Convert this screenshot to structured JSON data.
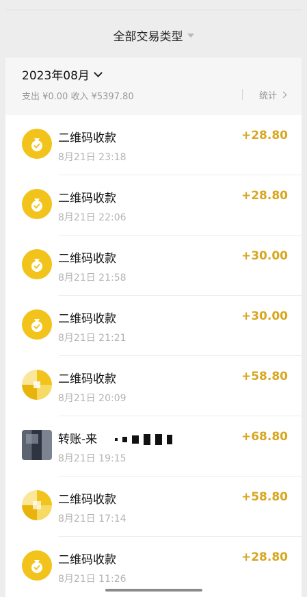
{
  "header": {
    "filter_label": "全部交易类型"
  },
  "month": {
    "label": "2023年08月",
    "summary": "支出 ¥0.00 收入 ¥5397.80",
    "stats_label": "统计"
  },
  "colors": {
    "accent_amount": "#d8a61f",
    "icon_yellow": "#f2c31a"
  },
  "transactions": [
    {
      "title": "二维码收款",
      "time": "8月21日 23:18",
      "amount": "+28.80",
      "icon": "money-bag-icon"
    },
    {
      "title": "二维码收款",
      "time": "8月21日 22:06",
      "amount": "+28.80",
      "icon": "money-bag-icon"
    },
    {
      "title": "二维码收款",
      "time": "8月21日 21:58",
      "amount": "+30.00",
      "icon": "money-bag-icon"
    },
    {
      "title": "二维码收款",
      "time": "8月21日 21:21",
      "amount": "+30.00",
      "icon": "money-bag-icon"
    },
    {
      "title": "二维码收款",
      "time": "8月21日 20:09",
      "amount": "+58.80",
      "icon": "money-bag-icon"
    },
    {
      "title": "转账-来",
      "time": "8月21日 19:15",
      "amount": "+68.80",
      "icon": "user-avatar"
    },
    {
      "title": "二维码收款",
      "time": "8月21日 17:14",
      "amount": "+58.80",
      "icon": "money-bag-icon"
    },
    {
      "title": "二维码收款",
      "time": "8月21日 11:26",
      "amount": "+28.80",
      "icon": "money-bag-icon"
    }
  ]
}
